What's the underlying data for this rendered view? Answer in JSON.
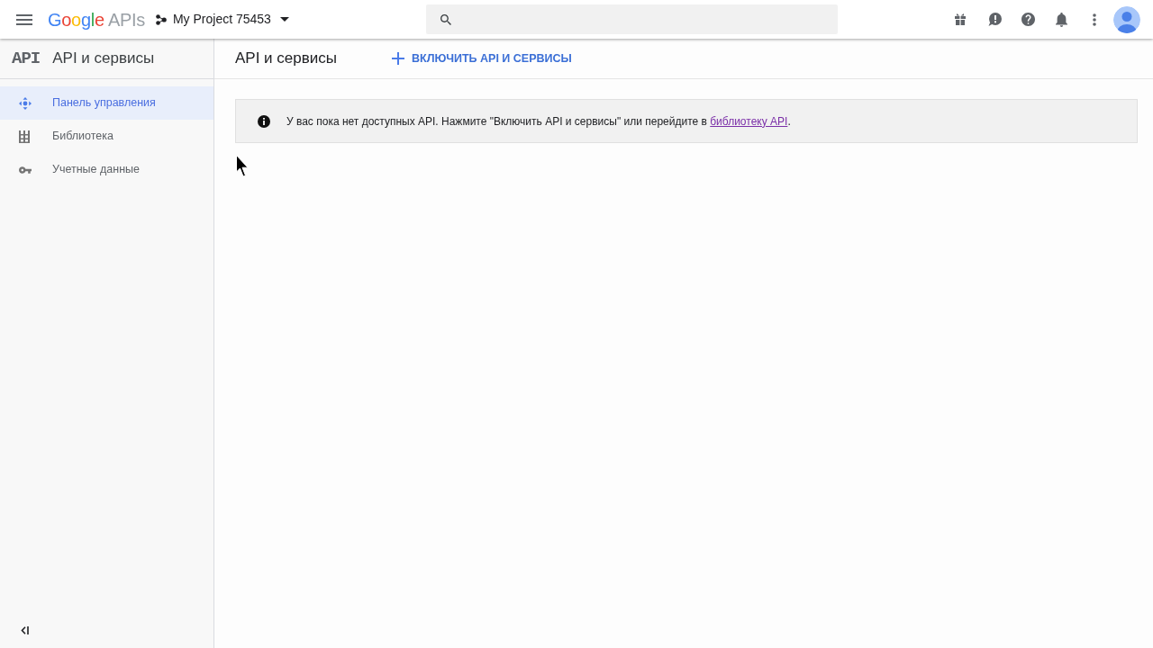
{
  "top_bar": {
    "logo": {
      "brand": "Google",
      "product": "APIs"
    },
    "project": "My Project 75453"
  },
  "sidebar": {
    "logo": "API",
    "title": "API и сервисы",
    "items": [
      {
        "label": "Панель управления",
        "selected": true
      },
      {
        "label": "Библиотека",
        "selected": false
      },
      {
        "label": "Учетные данные",
        "selected": false
      }
    ]
  },
  "main": {
    "title": "API и сервисы",
    "action": "ВКЛЮЧИТЬ API И СЕРВИСЫ",
    "notice": {
      "text": "У вас пока нет доступных API. Нажмите \"Включить API и сервисы\" или перейдите в ",
      "link": "библиотеку API",
      "text_after": "."
    }
  }
}
